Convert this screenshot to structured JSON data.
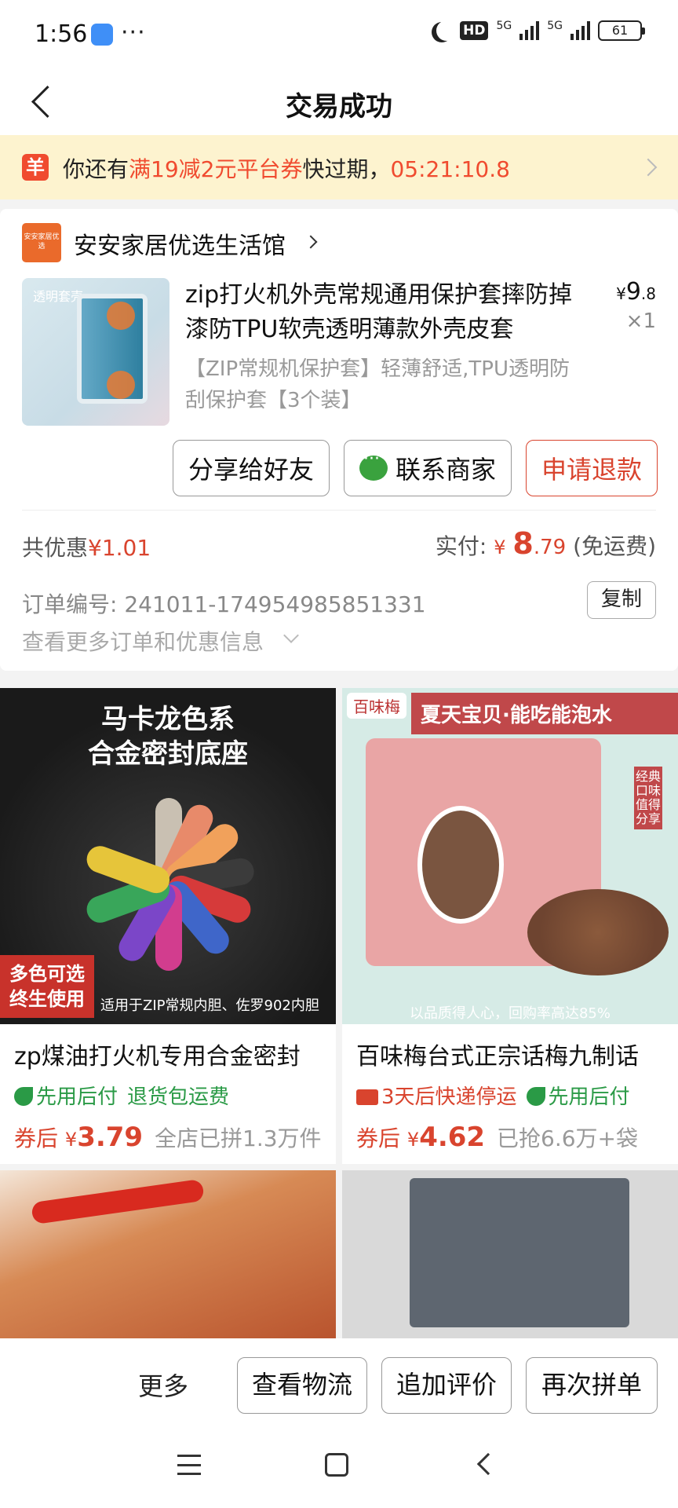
{
  "status_bar": {
    "time": "1:56",
    "dots": "···",
    "hd": "HD",
    "net1": "5G",
    "net2": "5G",
    "battery": "61"
  },
  "header": {
    "title": "交易成功"
  },
  "coupon_banner": {
    "icon": "羊",
    "prefix": "你还有",
    "coupon": "满19减2元平台券",
    "middle": "快过期，",
    "countdown": "05:21:10.8"
  },
  "store": {
    "logo_text": "安安家居优选",
    "name": "安安家居优选生活馆"
  },
  "product": {
    "image_label": "透明套壳",
    "title": "zip打火机外壳常规通用保护套摔防掉漆防TPU软壳透明薄款外壳皮套",
    "spec": "【ZIP常规机保护套】轻薄舒适,TPU透明防刮保护套【3个装】",
    "price_currency": "¥",
    "price_int": "9",
    "price_dec": ".8",
    "qty": "×1"
  },
  "actions": {
    "share": "分享给好友",
    "contact": "联系商家",
    "refund": "申请退款"
  },
  "summary": {
    "discount_label": "共优惠",
    "discount_value": "¥1.01",
    "paid_label": "实付:",
    "paid_currency": "¥",
    "paid_int": "8",
    "paid_dec": ".79",
    "shipping": "(免运费)"
  },
  "order": {
    "number_label": "订单编号:",
    "number": "241011-174954985851331",
    "copy": "复制",
    "more": "查看更多订单和优惠信息"
  },
  "recommendations": [
    {
      "image_title": "马卡龙色系\n合金密封底座",
      "image_corner": "多色可选\n终生使用",
      "image_caption": "适用于ZIP常规内胆、佐罗902内胆",
      "title": "zp煤油打火机专用合金密封",
      "tags": [
        "先用后付",
        "退货包运费"
      ],
      "price_label": "券后",
      "currency": "¥",
      "price": "3.79",
      "sold": "全店已拼1.3万件"
    },
    {
      "image_brand": "百味梅",
      "image_banner": "夏天宝贝·能吃能泡水",
      "image_vertical": "经典口味值得分享",
      "image_slogan": "以品质得人心，回购率高达85%",
      "title": "百味梅台式正宗话梅九制话",
      "tags": [
        "3天后快递停运",
        "先用后付"
      ],
      "price_label": "券后",
      "currency": "¥",
      "price": "4.62",
      "sold": "已抢6.6万+袋"
    }
  ],
  "bottom_bar": {
    "more": "更多",
    "logistics": "查看物流",
    "review": "追加评价",
    "reorder": "再次拼单"
  },
  "colors": {
    "accent": "#d9442e",
    "banner_bg": "#fdf3cf",
    "green": "#2a9a46"
  }
}
